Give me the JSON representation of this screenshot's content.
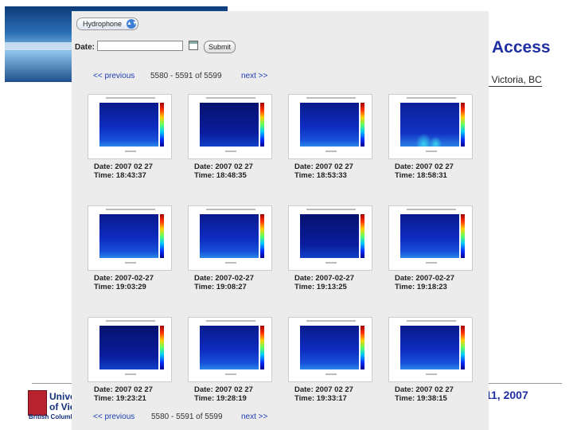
{
  "slide": {
    "title": "Access",
    "subtitle": ", Victoria, BC",
    "date": "11, 2007",
    "logo_line1": "Unive",
    "logo_line2": "of Vic",
    "logo_line3": "British Columbia"
  },
  "toolbar": {
    "instrument_select": "Hydrophone",
    "date_label": "Date:",
    "date_value": "",
    "submit_label": "Submit"
  },
  "pager_top": {
    "previous": "<< previous",
    "range": "5580 - 5591 of 5599",
    "next": "next >>"
  },
  "pager_bottom": {
    "previous": "<< previous",
    "range": "5580 - 5591 of 5599",
    "next": "next >>"
  },
  "thumbnails": [
    {
      "date": "Date: 2007 02 27",
      "time": "Time: 18:43:37"
    },
    {
      "date": "Date: 2007 02 27",
      "time": "Time: 18:48:35"
    },
    {
      "date": "Date: 2007 02 27",
      "time": "Time: 18:53:33"
    },
    {
      "date": "Date: 2007 02 27",
      "time": "Time: 18:58:31"
    },
    {
      "date": "Date: 2007-02-27",
      "time": "Time: 19:03:29"
    },
    {
      "date": "Date: 2007-02-27",
      "time": "Time: 19:08:27"
    },
    {
      "date": "Date: 2007-02-27",
      "time": "Time: 19:13:25"
    },
    {
      "date": "Date: 2007-02-27",
      "time": "Time: 19:18:23"
    },
    {
      "date": "Date: 2007 02 27",
      "time": "Time: 19:23:21"
    },
    {
      "date": "Date: 2007 02 27",
      "time": "Time: 19:28:19"
    },
    {
      "date": "Date: 2007 02 27",
      "time": "Time: 19:33:17"
    },
    {
      "date": "Date: 2007 02 27",
      "time": "Time: 19:38:15"
    }
  ]
}
